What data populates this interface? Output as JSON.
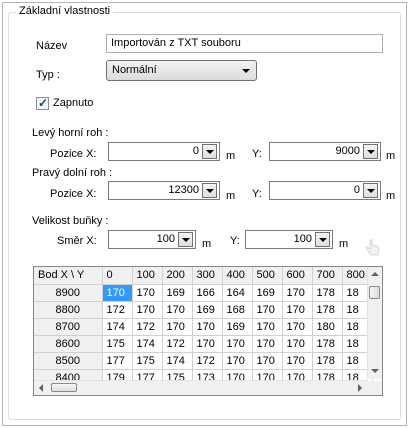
{
  "group": {
    "title": "Základní vlastnosti"
  },
  "name": {
    "label": "Název",
    "value": "Importován z TXT souboru"
  },
  "type": {
    "label": "Typ :",
    "value": "Normální"
  },
  "enabled": {
    "label": "Zapnuto",
    "checked": true
  },
  "top_left": {
    "label": "Levý horní roh :",
    "x_label": "Pozice X:",
    "x_value": "0",
    "x_unit": "m",
    "y_label": "Y:",
    "y_value": "9000",
    "y_unit": "m"
  },
  "bottom_right": {
    "label": "Pravý dolní roh :",
    "x_label": "Pozice X:",
    "x_value": "12300",
    "x_unit": "m",
    "y_label": "Y:",
    "y_value": "0",
    "y_unit": "m"
  },
  "cell_size": {
    "label": "Velikost buňky :",
    "x_label": "Směr X:",
    "x_value": "100",
    "x_unit": "m",
    "y_label": "Y:",
    "y_value": "100",
    "y_unit": "m"
  },
  "grid": {
    "corner_header": "Bod  X \\ Y",
    "columns": [
      "0",
      "100",
      "200",
      "300",
      "400",
      "500",
      "600",
      "700",
      "800"
    ],
    "rows": [
      {
        "y": "8900",
        "cells": [
          "170",
          "170",
          "169",
          "166",
          "164",
          "169",
          "170",
          "178",
          "18"
        ]
      },
      {
        "y": "8800",
        "cells": [
          "172",
          "170",
          "170",
          "169",
          "168",
          "170",
          "170",
          "178",
          "18"
        ]
      },
      {
        "y": "8700",
        "cells": [
          "174",
          "172",
          "170",
          "170",
          "169",
          "170",
          "170",
          "180",
          "18"
        ]
      },
      {
        "y": "8600",
        "cells": [
          "175",
          "174",
          "172",
          "170",
          "170",
          "170",
          "170",
          "178",
          "18"
        ]
      },
      {
        "y": "8500",
        "cells": [
          "177",
          "175",
          "174",
          "172",
          "170",
          "170",
          "170",
          "178",
          "18"
        ]
      },
      {
        "y": "8400",
        "cells": [
          "179",
          "177",
          "175",
          "173",
          "170",
          "170",
          "170",
          "178",
          "18"
        ]
      }
    ]
  }
}
